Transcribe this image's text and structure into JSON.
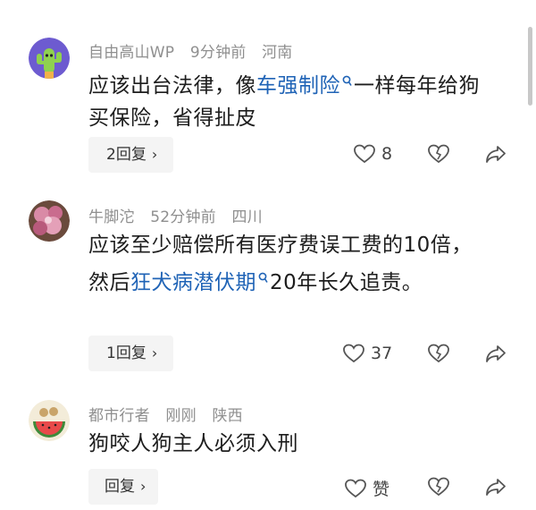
{
  "comments": [
    {
      "username": "自由高山WP",
      "time": "9分钟前",
      "location": "河南",
      "text_before": "应该出台法律，像",
      "keyword": "车强制险",
      "text_after": "一样每年给狗买保险，省得扯皮",
      "reply_label": "2回复",
      "likes": "8",
      "avatar": "cactus-avatar"
    },
    {
      "username": "牛脚沱",
      "time": "52分钟前",
      "location": "四川",
      "text_before": "应该至少赔偿所有医疗费误工费的10倍，然后",
      "keyword": "狂犬病潜伏期",
      "text_after": "20年长久追责。",
      "reply_label": "1回复",
      "likes": "37",
      "avatar": "flower-avatar"
    },
    {
      "username": "都市行者",
      "time": "刚刚",
      "location": "陕西",
      "text_before": "狗咬人狗主人必须入刑",
      "keyword": "",
      "text_after": "",
      "reply_label": "回复",
      "likes": "赞",
      "avatar": "watermelon-avatar"
    }
  ],
  "icons": [
    "heart-icon",
    "dislike-heart-icon",
    "share-icon",
    "search-icon",
    "chevron-right-icon"
  ],
  "colors": {
    "keyword": "#1f63b6",
    "meta": "#8f8f8f",
    "text": "#1d1d1d",
    "reply_bg": "#f4f4f4"
  }
}
